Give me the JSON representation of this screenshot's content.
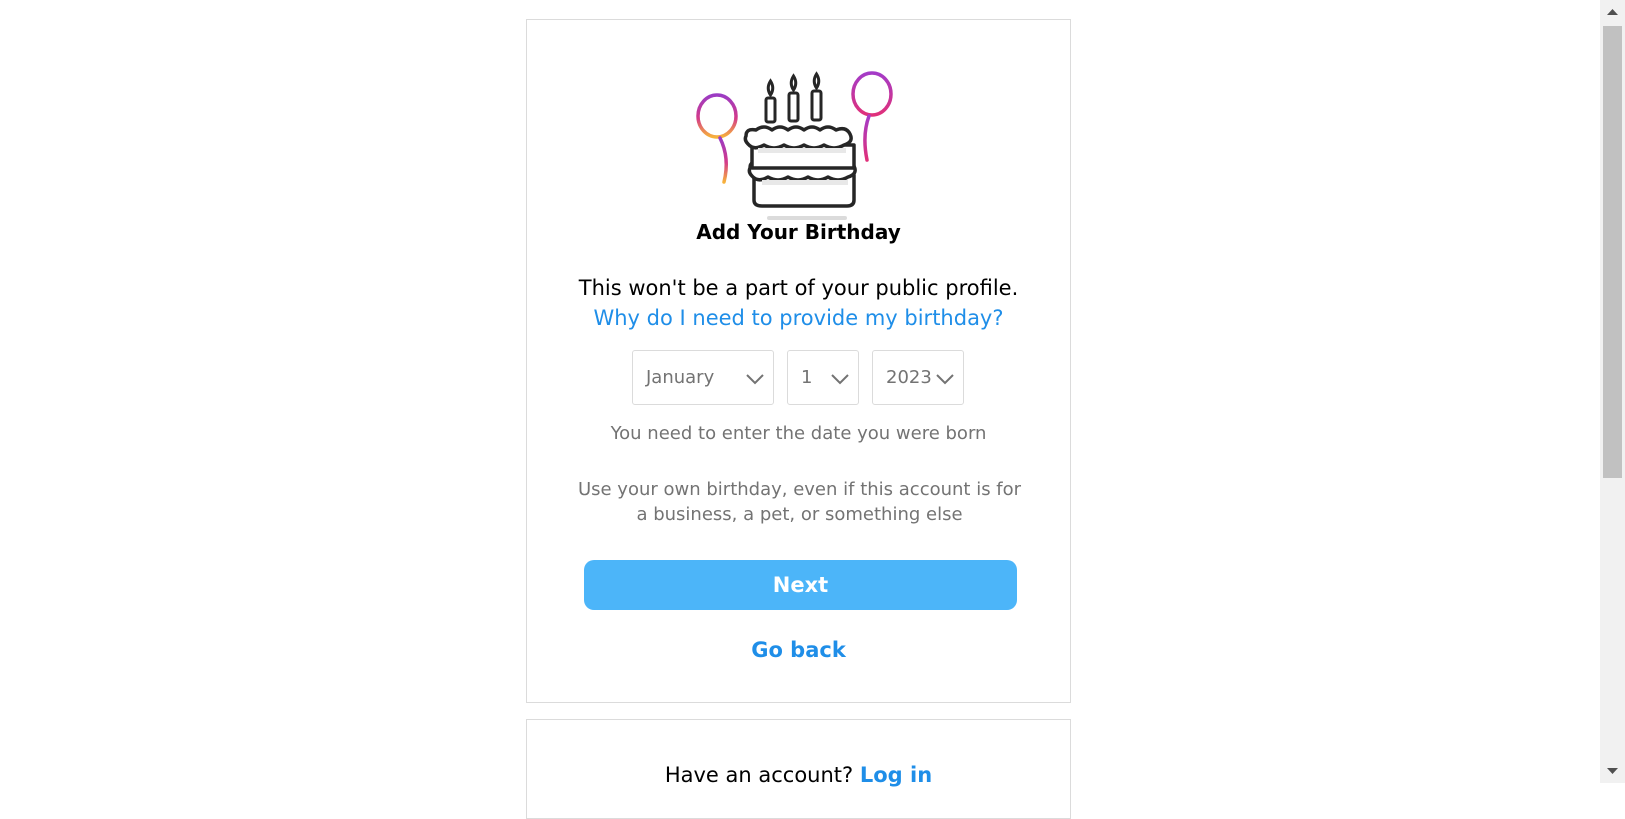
{
  "birthday": {
    "title": "Add Your Birthday",
    "lead": "This won't be a part of your public profile.",
    "why_link": "Why do I need to provide my birthday?",
    "month": "January",
    "day": "1",
    "year": "2023",
    "hint": "You need to enter the date you were born",
    "note": "Use your own birthday, even if this account is for a business, a pet, or something else",
    "next_label": "Next",
    "go_back_label": "Go back"
  },
  "footer": {
    "have_account": "Have an account?",
    "login_label": "Log in"
  },
  "colors": {
    "accent": "#4cb5f9",
    "link": "#1f8ee8",
    "border": "#dbdbdb",
    "muted": "#737373"
  },
  "icons": {
    "illustration": "birthday-cake-with-balloons-illustration",
    "select_chevron": "chevron-down-icon",
    "scroll_up": "triangle-up-icon",
    "scroll_down": "triangle-down-icon"
  }
}
